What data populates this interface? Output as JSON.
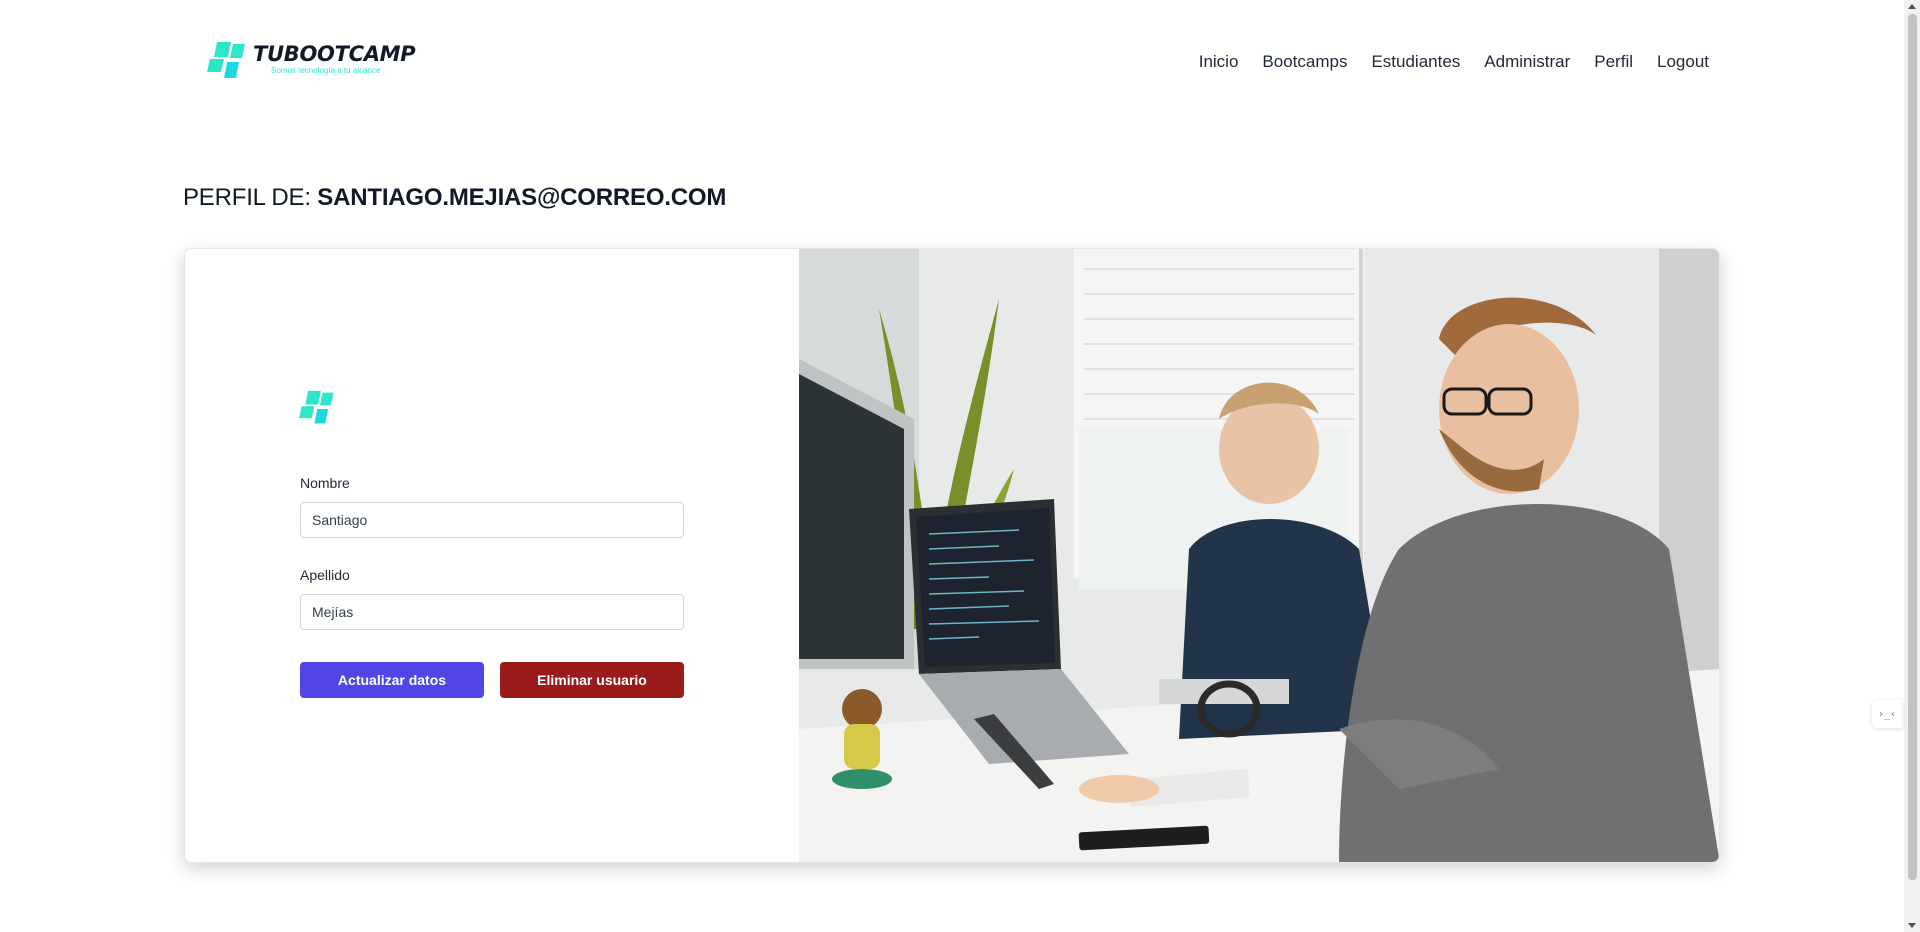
{
  "brand": {
    "name": "TUBOOTCAMP",
    "tagline": "Somos tecnología a tu alcance",
    "mark_color": "#2ee6c8"
  },
  "nav": {
    "links": [
      "Inicio",
      "Bootcamps",
      "Estudiantes",
      "Administrar",
      "Perfil",
      "Logout"
    ]
  },
  "heading": {
    "prefix": "PERFIL DE:",
    "email": "SANTIAGO.MEJIAS@CORREO.COM"
  },
  "form": {
    "nombre_label": "Nombre",
    "nombre_value": "Santiago",
    "apellido_label": "Apellido",
    "apellido_value": "Mejías",
    "update_label": "Actualizar datos",
    "delete_label": "Eliminar usuario"
  },
  "colors": {
    "primary": "#4f46e5",
    "danger": "#991b1b",
    "accent": "#2ee6c8"
  },
  "icons": {
    "logo": "tilted-squares-logo-icon",
    "widget": "code-icon"
  },
  "widget": {
    "label": "›_‹"
  }
}
